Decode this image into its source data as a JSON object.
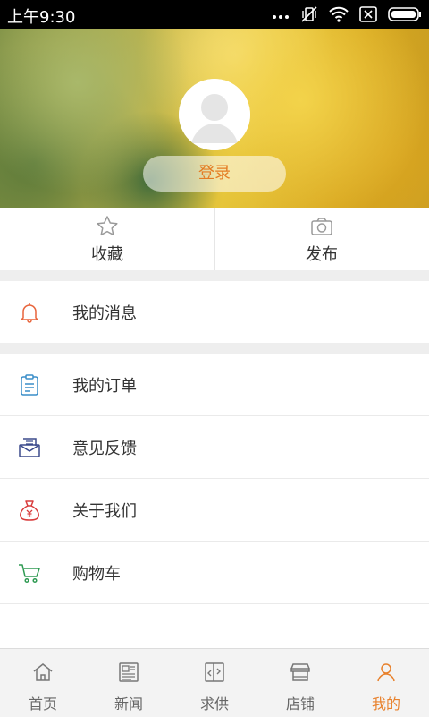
{
  "status_bar": {
    "time": "上午9:30",
    "icons": [
      "more-dots-icon",
      "vibrate-off-icon",
      "wifi-icon",
      "sim-off-icon",
      "battery-icon"
    ]
  },
  "profile": {
    "login_label": "登录",
    "avatar_icon": "default-avatar-icon"
  },
  "quick_actions": [
    {
      "label": "收藏",
      "icon": "star-icon"
    },
    {
      "label": "发布",
      "icon": "camera-icon"
    }
  ],
  "menu": [
    {
      "label": "我的消息",
      "icon": "bell-icon",
      "color": "#e8643b"
    },
    {
      "label": "我的订单",
      "icon": "clipboard-icon",
      "color": "#3a8ec9"
    },
    {
      "label": "意见反馈",
      "icon": "envelope-icon",
      "color": "#3b4a8c"
    },
    {
      "label": "关于我们",
      "icon": "money-bag-icon",
      "color": "#d93c3c"
    },
    {
      "label": "购物车",
      "icon": "cart-icon",
      "color": "#2e9a52"
    }
  ],
  "bottom_nav": {
    "items": [
      {
        "label": "首页",
        "icon": "home-icon"
      },
      {
        "label": "新闻",
        "icon": "news-icon"
      },
      {
        "label": "求供",
        "icon": "supply-demand-icon"
      },
      {
        "label": "店铺",
        "icon": "store-icon"
      },
      {
        "label": "我的",
        "icon": "user-icon"
      }
    ],
    "active_index": 4,
    "active_color": "#e8812c"
  }
}
